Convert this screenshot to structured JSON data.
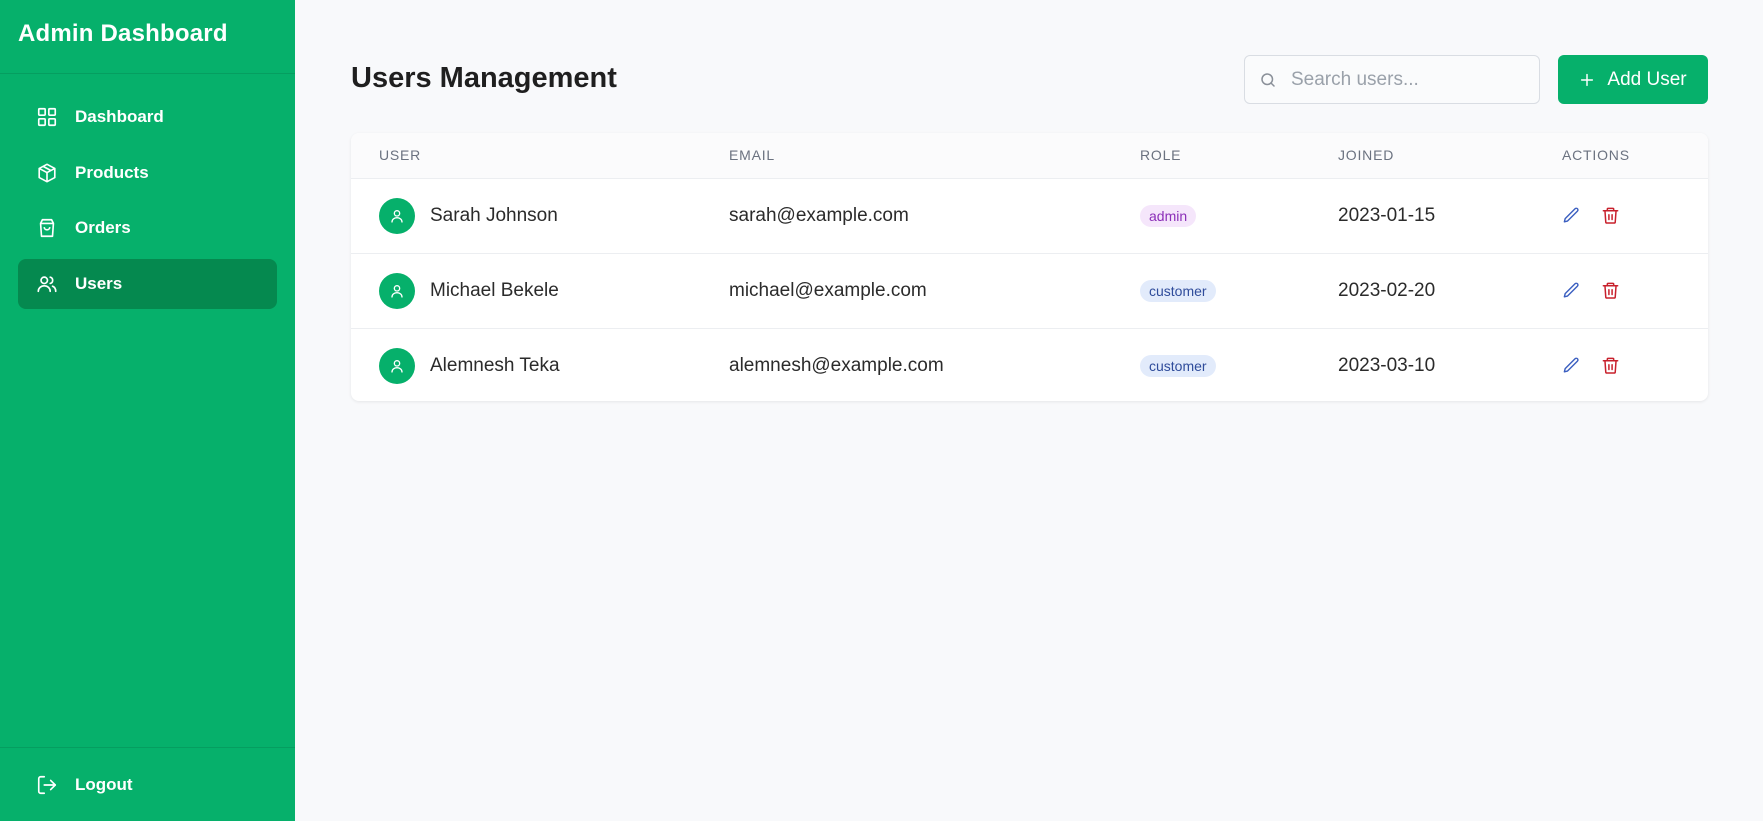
{
  "brand": {
    "title": "Admin Dashboard"
  },
  "sidebar": {
    "items": [
      {
        "label": "Dashboard",
        "icon": "grid-icon",
        "active": false
      },
      {
        "label": "Products",
        "icon": "package-icon",
        "active": false
      },
      {
        "label": "Orders",
        "icon": "shopping-bag-icon",
        "active": false
      },
      {
        "label": "Users",
        "icon": "users-icon",
        "active": true
      }
    ],
    "logout_label": "Logout"
  },
  "header": {
    "title": "Users Management",
    "search_placeholder": "Search users...",
    "add_user_label": "Add User"
  },
  "table": {
    "columns": [
      "USER",
      "EMAIL",
      "ROLE",
      "JOINED",
      "ACTIONS"
    ],
    "rows": [
      {
        "name": "Sarah Johnson",
        "email": "sarah@example.com",
        "role": "admin",
        "joined": "2023-01-15"
      },
      {
        "name": "Michael Bekele",
        "email": "michael@example.com",
        "role": "customer",
        "joined": "2023-02-20"
      },
      {
        "name": "Alemnesh Teka",
        "email": "alemnesh@example.com",
        "role": "customer",
        "joined": "2023-03-10"
      }
    ]
  },
  "colors": {
    "primary": "#06b06b",
    "primary_dark": "#05894f",
    "admin_badge_bg": "#f5e6fb",
    "admin_badge_text": "#8b2fb8",
    "customer_badge_bg": "#e2ebfb",
    "customer_badge_text": "#2f4c9b",
    "edit_icon": "#3b5fc0",
    "delete_icon": "#c8202c"
  }
}
